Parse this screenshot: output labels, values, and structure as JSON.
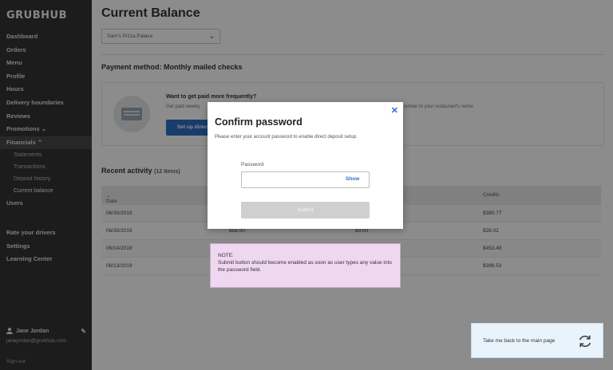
{
  "sidebar": {
    "logo": "GRUBHUB",
    "nav": [
      "Dashboard",
      "Orders",
      "Menu",
      "Profile",
      "Hours",
      "Delivery boundaries",
      "Reviews",
      "Promotions",
      "Financials",
      "Users"
    ],
    "promotions_suffix": "⌄",
    "financials_suffix": "⌃",
    "financials_sub": [
      "Statements",
      "Transactions",
      "Deposit history",
      "Current balance"
    ],
    "secondary": [
      "Rate your drivers",
      "Settings",
      "Learning Center"
    ],
    "user_name": "Jane Jordan",
    "user_email": "janejordan@grubhub.com",
    "signout": "Sign out"
  },
  "main": {
    "title": "Current Balance",
    "select_value": "Sam's Pizza Palace",
    "payment_method": "Payment method: Monthly mailed checks",
    "promo_title": "Want to get paid more frequently?",
    "promo_text": "Get paid weekly",
    "promo_text_right": "similar to your restaurant's name",
    "setup_button": "Set up direct deposit",
    "recent_title": "Recent activity",
    "recent_count": "(12 Items)",
    "table": {
      "headers": [
        "Date",
        "",
        "",
        "Credits"
      ],
      "rows": [
        {
          "date": "06/30/2019",
          "c2": "",
          "c3": "",
          "credit": "$380.77"
        },
        {
          "date": "06/30/2019",
          "c2": "$58.00",
          "c3": "$0.00",
          "credit": "$28.02"
        },
        {
          "date": "06/14/2019",
          "c2": "",
          "c3": "",
          "credit": "$453.48"
        },
        {
          "date": "06/13/2019",
          "c2": "",
          "c3": "",
          "credit": "$396.53"
        }
      ]
    }
  },
  "modal": {
    "title": "Confirm password",
    "description": "Please enter your account password to enable direct deposit setup.",
    "password_label": "Password",
    "password_value": "",
    "show_label": "Show",
    "submit_label": "Submit",
    "close_icon": "✕"
  },
  "note": {
    "heading": "NOTE:",
    "text": "Submit button should become enabled as soon as user types any value into the password field."
  },
  "back_card": {
    "text": "Take me back to the main page",
    "icon": "refresh-icon"
  },
  "colors": {
    "sidebar_bg": "#333333",
    "accent": "#2c6fc7",
    "note_bg": "#eed8f0",
    "back_card_bg": "#e8f3fb",
    "overlay": "rgba(0,0,0,0.45)"
  }
}
